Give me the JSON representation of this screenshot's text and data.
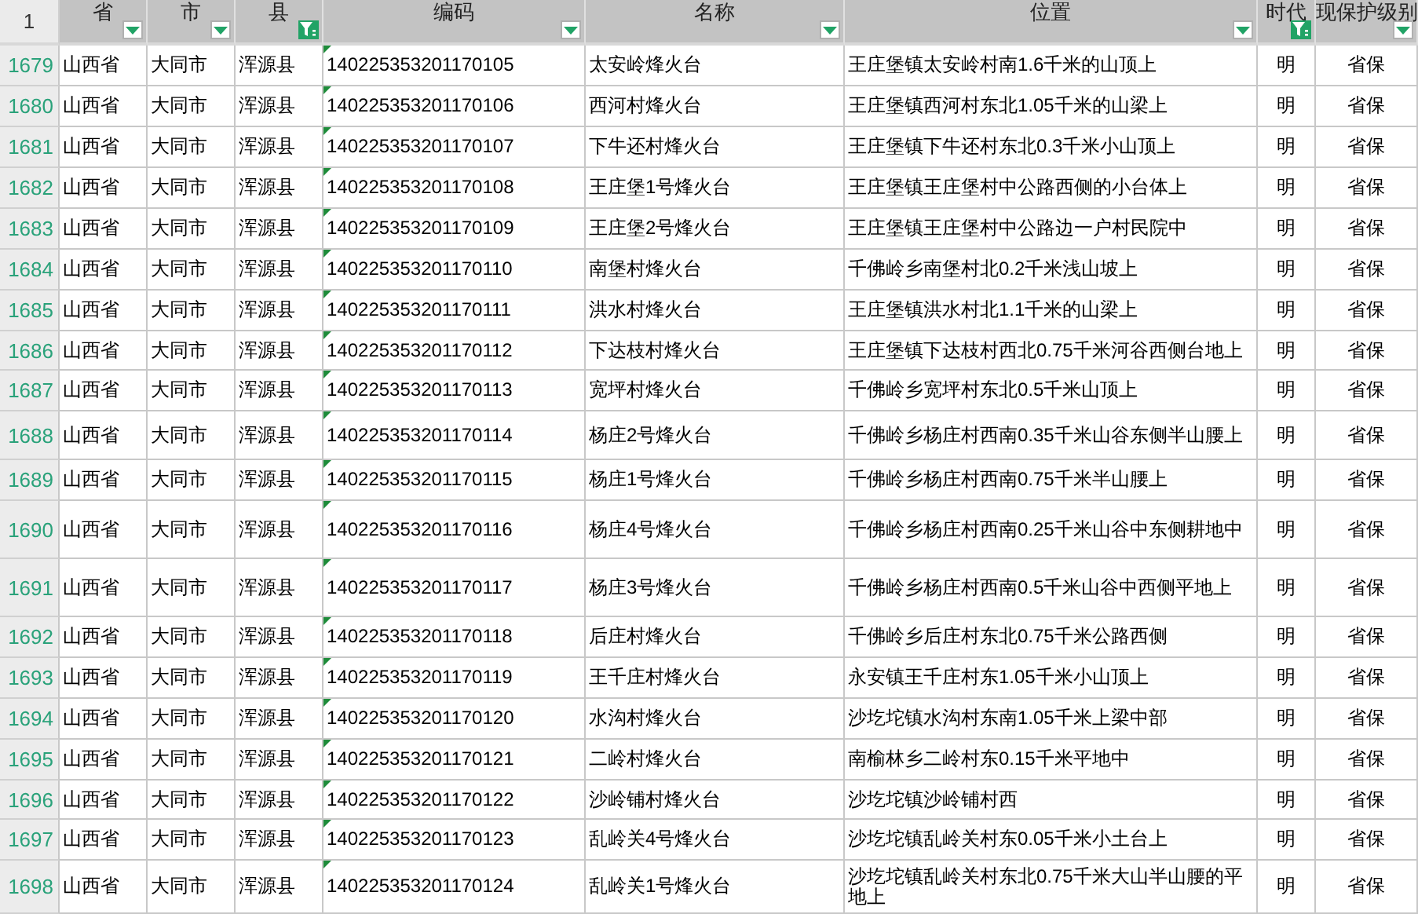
{
  "corner": "1",
  "columns": [
    {
      "label": "省",
      "filtered": false
    },
    {
      "label": "市",
      "filtered": false
    },
    {
      "label": "县",
      "filtered": true
    },
    {
      "label": "编码",
      "filtered": false,
      "flagged": true
    },
    {
      "label": "名称",
      "filtered": false
    },
    {
      "label": "位置",
      "filtered": false
    },
    {
      "label": "时代",
      "filtered": true
    },
    {
      "label": "现保护级别",
      "filtered": false
    }
  ],
  "rows": [
    {
      "number": "1679",
      "cells": [
        "山西省",
        "大同市",
        "浑源县",
        "140225353201170105",
        "太安岭烽火台",
        "王庄堡镇太安岭村南1.6千米的山顶上",
        "明",
        "省保"
      ]
    },
    {
      "number": "1680",
      "cells": [
        "山西省",
        "大同市",
        "浑源县",
        "140225353201170106",
        "西河村烽火台",
        "王庄堡镇西河村东北1.05千米的山梁上",
        "明",
        "省保"
      ]
    },
    {
      "number": "1681",
      "cells": [
        "山西省",
        "大同市",
        "浑源县",
        "140225353201170107",
        "下牛还村烽火台",
        "王庄堡镇下牛还村东北0.3千米小山顶上",
        "明",
        "省保"
      ]
    },
    {
      "number": "1682",
      "cells": [
        "山西省",
        "大同市",
        "浑源县",
        "140225353201170108",
        "王庄堡1号烽火台",
        "王庄堡镇王庄堡村中公路西侧的小台体上",
        "明",
        "省保"
      ]
    },
    {
      "number": "1683",
      "cells": [
        "山西省",
        "大同市",
        "浑源县",
        "140225353201170109",
        "王庄堡2号烽火台",
        "王庄堡镇王庄堡村中公路边一户村民院中",
        "明",
        "省保"
      ]
    },
    {
      "number": "1684",
      "cells": [
        "山西省",
        "大同市",
        "浑源县",
        "140225353201170110",
        "南堡村烽火台",
        "千佛岭乡南堡村北0.2千米浅山坡上",
        "明",
        "省保"
      ]
    },
    {
      "number": "1685",
      "cells": [
        "山西省",
        "大同市",
        "浑源县",
        "140225353201170111",
        "洪水村烽火台",
        "王庄堡镇洪水村北1.1千米的山梁上",
        "明",
        "省保"
      ]
    },
    {
      "number": "1686",
      "cells": [
        "山西省",
        "大同市",
        "浑源县",
        "140225353201170112",
        "下达枝村烽火台",
        "王庄堡镇下达枝村西北0.75千米河谷西侧台地上",
        "明",
        "省保"
      ]
    },
    {
      "number": "1687",
      "cells": [
        "山西省",
        "大同市",
        "浑源县",
        "140225353201170113",
        "宽坪村烽火台",
        "千佛岭乡宽坪村东北0.5千米山顶上",
        "明",
        "省保"
      ]
    },
    {
      "number": "1688",
      "cells": [
        "山西省",
        "大同市",
        "浑源县",
        "140225353201170114",
        "杨庄2号烽火台",
        "千佛岭乡杨庄村西南0.35千米山谷东侧半山腰上",
        "明",
        "省保"
      ]
    },
    {
      "number": "1689",
      "cells": [
        "山西省",
        "大同市",
        "浑源县",
        "140225353201170115",
        "杨庄1号烽火台",
        "千佛岭乡杨庄村西南0.75千米半山腰上",
        "明",
        "省保"
      ]
    },
    {
      "number": "1690",
      "cells": [
        "山西省",
        "大同市",
        "浑源县",
        "140225353201170116",
        "杨庄4号烽火台",
        "千佛岭乡杨庄村西南0.25千米山谷中东侧耕地中",
        "明",
        "省保"
      ]
    },
    {
      "number": "1691",
      "cells": [
        "山西省",
        "大同市",
        "浑源县",
        "140225353201170117",
        "杨庄3号烽火台",
        "千佛岭乡杨庄村西南0.5千米山谷中西侧平地上",
        "明",
        "省保"
      ]
    },
    {
      "number": "1692",
      "cells": [
        "山西省",
        "大同市",
        "浑源县",
        "140225353201170118",
        "后庄村烽火台",
        "千佛岭乡后庄村东北0.75千米公路西侧",
        "明",
        "省保"
      ]
    },
    {
      "number": "1693",
      "cells": [
        "山西省",
        "大同市",
        "浑源县",
        "140225353201170119",
        "王千庄村烽火台",
        "永安镇王千庄村东1.05千米小山顶上",
        "明",
        "省保"
      ]
    },
    {
      "number": "1694",
      "cells": [
        "山西省",
        "大同市",
        "浑源县",
        "140225353201170120",
        "水沟村烽火台",
        "沙圪坨镇水沟村东南1.05千米上梁中部",
        "明",
        "省保"
      ]
    },
    {
      "number": "1695",
      "cells": [
        "山西省",
        "大同市",
        "浑源县",
        "140225353201170121",
        "二岭村烽火台",
        "南榆林乡二岭村东0.15千米平地中",
        "明",
        "省保"
      ]
    },
    {
      "number": "1696",
      "cells": [
        "山西省",
        "大同市",
        "浑源县",
        "140225353201170122",
        "沙岭铺村烽火台",
        "沙圪坨镇沙岭铺村西",
        "明",
        "省保"
      ]
    },
    {
      "number": "1697",
      "cells": [
        "山西省",
        "大同市",
        "浑源县",
        "140225353201170123",
        "乱岭关4号烽火台",
        "沙圪坨镇乱岭关村东0.05千米小土台上",
        "明",
        "省保"
      ]
    },
    {
      "number": "1698",
      "cells": [
        "山西省",
        "大同市",
        "浑源县",
        "140225353201170124",
        "乱岭关1号烽火台",
        "沙圪坨镇乱岭关村东北0.75千米大山半山腰的平地上",
        "明",
        "省保"
      ]
    }
  ]
}
